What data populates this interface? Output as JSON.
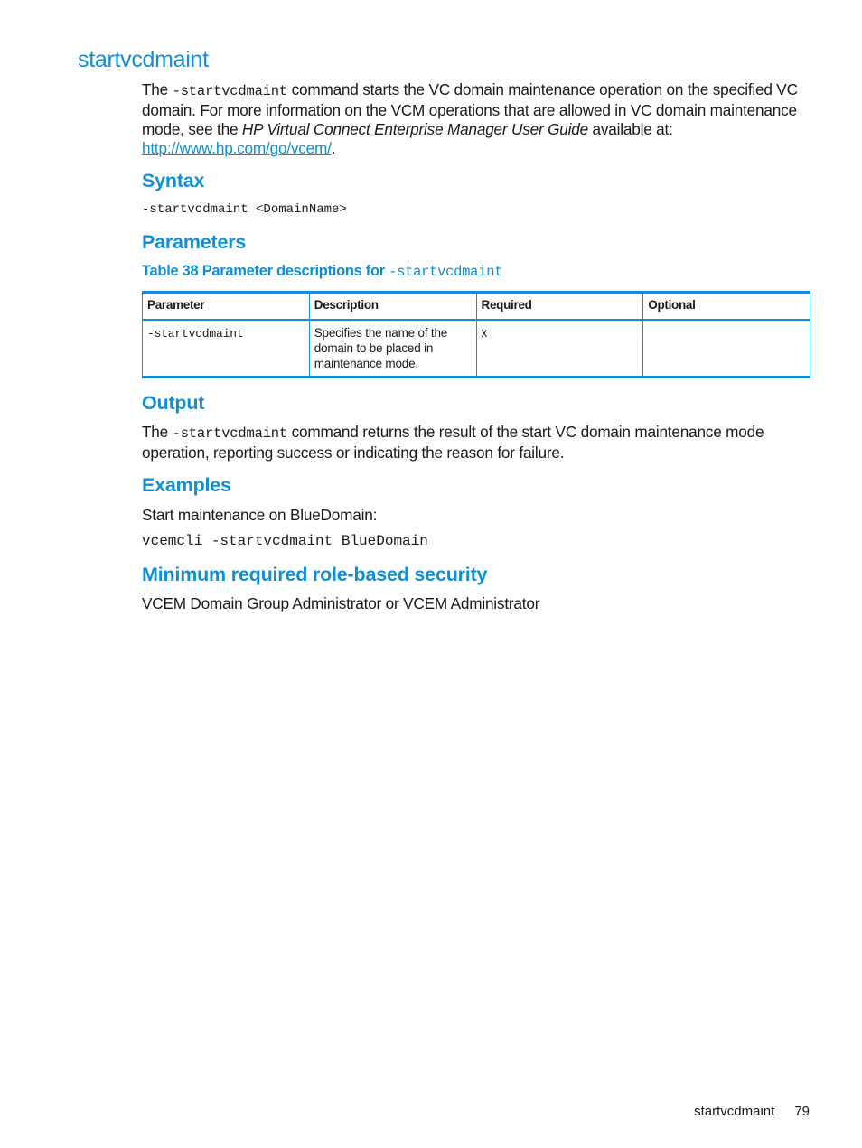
{
  "page_title": "startvcdmaint",
  "intro": {
    "prefix": "The ",
    "command": "-startvcdmaint",
    "text1": " command starts the VC domain maintenance operation on the specified VC domain. For more information on the VCM operations that are allowed in VC domain maintenance mode, see the ",
    "guide_title": "HP Virtual Connect Enterprise Manager User Guide",
    "text2": " available at: ",
    "link": "http://www.hp.com/go/vcem/",
    "suffix": "."
  },
  "syntax": {
    "heading": "Syntax",
    "code": "-startvcdmaint <DomainName>"
  },
  "parameters": {
    "heading": "Parameters",
    "caption_text": "Table 38 Parameter descriptions for ",
    "caption_command": "-startvcdmaint",
    "columns": [
      "Parameter",
      "Description",
      "Required",
      "Optional"
    ],
    "rows": [
      {
        "parameter": "-startvcdmaint",
        "description": "Specifies the name of the domain to be placed in maintenance mode.",
        "required": "x",
        "optional": ""
      }
    ]
  },
  "output": {
    "heading": "Output",
    "prefix": "The ",
    "command": "-startvcdmaint",
    "text": " command returns the result of the start VC domain maintenance mode operation, reporting success or indicating the reason for failure."
  },
  "examples": {
    "heading": "Examples",
    "description": "Start maintenance on BlueDomain:",
    "code": "vcemcli -startvcdmaint BlueDomain"
  },
  "security": {
    "heading": "Minimum required role-based security",
    "text": "VCEM Domain Group Administrator or VCEM Administrator"
  },
  "footer": {
    "section": "startvcdmaint",
    "page_number": "79"
  }
}
